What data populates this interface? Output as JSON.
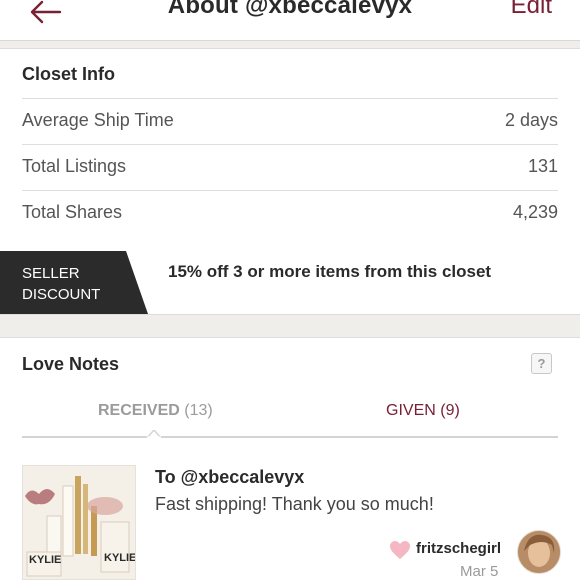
{
  "header": {
    "back_icon": "arrow-left-icon",
    "title": "About @xbeccalevyx",
    "edit_label": "Edit"
  },
  "closet_info": {
    "title": "Closet Info",
    "rows": [
      {
        "label": "Average Ship Time",
        "value": "2 days"
      },
      {
        "label": "Total Listings",
        "value": "131"
      },
      {
        "label": "Total Shares",
        "value": "4,239"
      }
    ]
  },
  "seller_discount": {
    "badge_line1": "SELLER",
    "badge_line2": "DISCOUNT",
    "text": "15% off 3 or more items from this closet"
  },
  "love_notes": {
    "title": "Love Notes",
    "help_icon": "question-mark-icon",
    "help_label": "?",
    "tabs": [
      {
        "label": "RECEIVED",
        "count": "(13)",
        "selected": true
      },
      {
        "label": "GIVEN",
        "count": "(9)",
        "selected": false
      }
    ],
    "note": {
      "to": "To @xbeccalevyx",
      "message": "Fast shipping! Thank you so much!",
      "author": "fritzschegirl",
      "date": "Mar 5",
      "product_text_1": "KYLIE",
      "product_text_2": "KYLIE"
    }
  },
  "colors": {
    "accent": "#7a2035",
    "badge_bg": "#2b2b2b",
    "heart": "#f4b7c3"
  }
}
